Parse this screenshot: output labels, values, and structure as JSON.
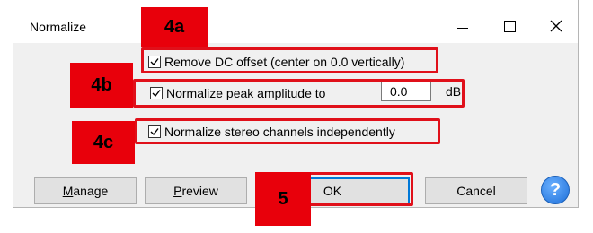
{
  "window": {
    "title": "Normalize"
  },
  "options": {
    "remove_dc": {
      "label": "Remove DC offset (center on 0.0 vertically)",
      "checked": true
    },
    "normalize_peak": {
      "label": "Normalize peak amplitude to",
      "checked": true,
      "value": "0.0",
      "unit": "dB"
    },
    "stereo_independent": {
      "label": "Normalize stereo channels independently",
      "checked": true
    }
  },
  "buttons": {
    "manage": "Manage",
    "preview": "Preview",
    "ok": "OK",
    "cancel": "Cancel",
    "help": "?"
  },
  "annotations": {
    "step_4a": "4a",
    "step_4b": "4b",
    "step_4c": "4c",
    "step_5": "5"
  },
  "colors": {
    "highlight": "#e0101a",
    "badge": "#e8000b",
    "help_blue": "#1e6fd8",
    "default_border": "#0078d7"
  }
}
